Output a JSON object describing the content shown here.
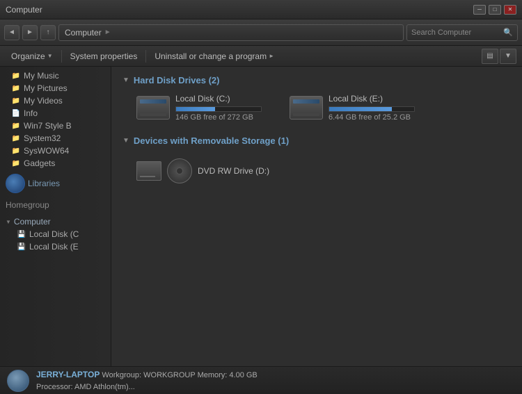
{
  "window": {
    "title": "Computer",
    "min_label": "─",
    "max_label": "□",
    "close_label": "✕"
  },
  "nav": {
    "back_icon": "◄",
    "forward_icon": "►",
    "up_icon": "↑",
    "breadcrumb": "Computer",
    "breadcrumb_arrow": "►",
    "search_placeholder": "Search Computer",
    "search_icon": "🔍"
  },
  "toolbar": {
    "organize_label": "Organize",
    "system_properties_label": "System properties",
    "uninstall_label": "Uninstall or change a program",
    "more_arrow": "►",
    "dropdown_arrow": "▼"
  },
  "sidebar": {
    "folders": [
      {
        "label": "My Music",
        "icon": "♪"
      },
      {
        "label": "My Pictures",
        "icon": "🖼"
      },
      {
        "label": "My Videos",
        "icon": "▶"
      },
      {
        "label": "Info",
        "icon": "📄"
      },
      {
        "label": "Win7 Style B",
        "icon": "📁"
      },
      {
        "label": "System32",
        "icon": "📁"
      },
      {
        "label": "SysWOW64",
        "icon": "📁"
      },
      {
        "label": "Gadgets",
        "icon": "📁"
      }
    ],
    "libraries_label": "Libraries",
    "homegroup_label": "Homegroup",
    "computer_label": "Computer",
    "local_disk_c": "Local Disk (C",
    "local_disk_e": "Local Disk (E"
  },
  "content": {
    "hard_drives_header": "Hard Disk Drives (2)",
    "drives": [
      {
        "name": "Local Disk (C:)",
        "free": "146 GB free of 272 GB",
        "fill_pct": 46
      },
      {
        "name": "Local Disk (E:)",
        "free": "6.44 GB free of 25.2 GB",
        "fill_pct": 74
      }
    ],
    "removable_header": "Devices with Removable Storage (1)",
    "dvd_drives": [
      {
        "name": "DVD RW Drive (D:)"
      }
    ]
  },
  "statusbar": {
    "computer_name": "JERRY-LAPTOP",
    "workgroup": "Workgroup: WORKGROUP",
    "memory": "Memory: 4.00 GB",
    "processor": "Processor: AMD Athlon(tm)..."
  }
}
